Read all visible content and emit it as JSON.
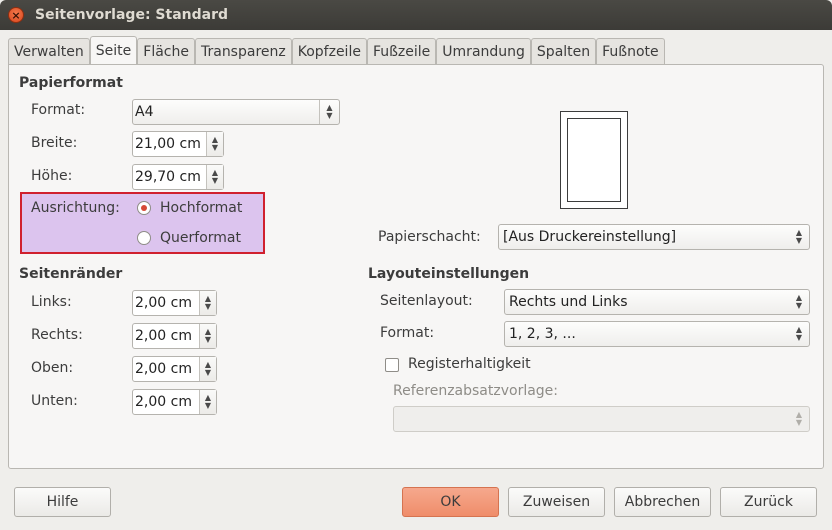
{
  "window": {
    "title": "Seitenvorlage: Standard"
  },
  "tabs": [
    {
      "label": "Verwalten"
    },
    {
      "label": "Seite",
      "active": true
    },
    {
      "label": "Fläche"
    },
    {
      "label": "Transparenz"
    },
    {
      "label": "Kopfzeile"
    },
    {
      "label": "Fußzeile"
    },
    {
      "label": "Umrandung"
    },
    {
      "label": "Spalten"
    },
    {
      "label": "Fußnote"
    }
  ],
  "paper": {
    "section_title": "Papierformat",
    "format_label": "Format:",
    "format_value": "A4",
    "width_label": "Breite:",
    "width_value": "21,00 cm",
    "height_label": "Höhe:",
    "height_value": "29,70 cm",
    "orientation_label": "Ausrichtung:",
    "portrait_label": "Hochformat",
    "landscape_label": "Querformat",
    "orientation_selected": "Hochformat",
    "tray_label": "Papierschacht:",
    "tray_value": "[Aus Druckereinstellung]"
  },
  "margins": {
    "section_title": "Seitenränder",
    "left_label": "Links:",
    "left_value": "2,00 cm",
    "right_label": "Rechts:",
    "right_value": "2,00 cm",
    "top_label": "Oben:",
    "top_value": "2,00 cm",
    "bottom_label": "Unten:",
    "bottom_value": "2,00 cm"
  },
  "layout": {
    "section_title": "Layouteinstellungen",
    "page_layout_label": "Seitenlayout:",
    "page_layout_value": "Rechts und Links",
    "format_label": "Format:",
    "format_value": "1, 2, 3, ...",
    "register_label": "Registerhaltigkeit",
    "register_checked": false,
    "reference_label": "Referenzabsatzvorlage:",
    "reference_value": ""
  },
  "buttons": {
    "help": "Hilfe",
    "ok": "OK",
    "apply": "Zuweisen",
    "cancel": "Abbrechen",
    "reset": "Zurück"
  },
  "colors": {
    "highlight_fill": "#dcc4ee",
    "highlight_border": "#d0202e",
    "ok_button": "#ef8d6a",
    "radio_selected": "#d64937"
  },
  "icons": {
    "close": "close-icon",
    "spin_up": "chevron-up-icon",
    "spin_down": "chevron-down-icon"
  }
}
